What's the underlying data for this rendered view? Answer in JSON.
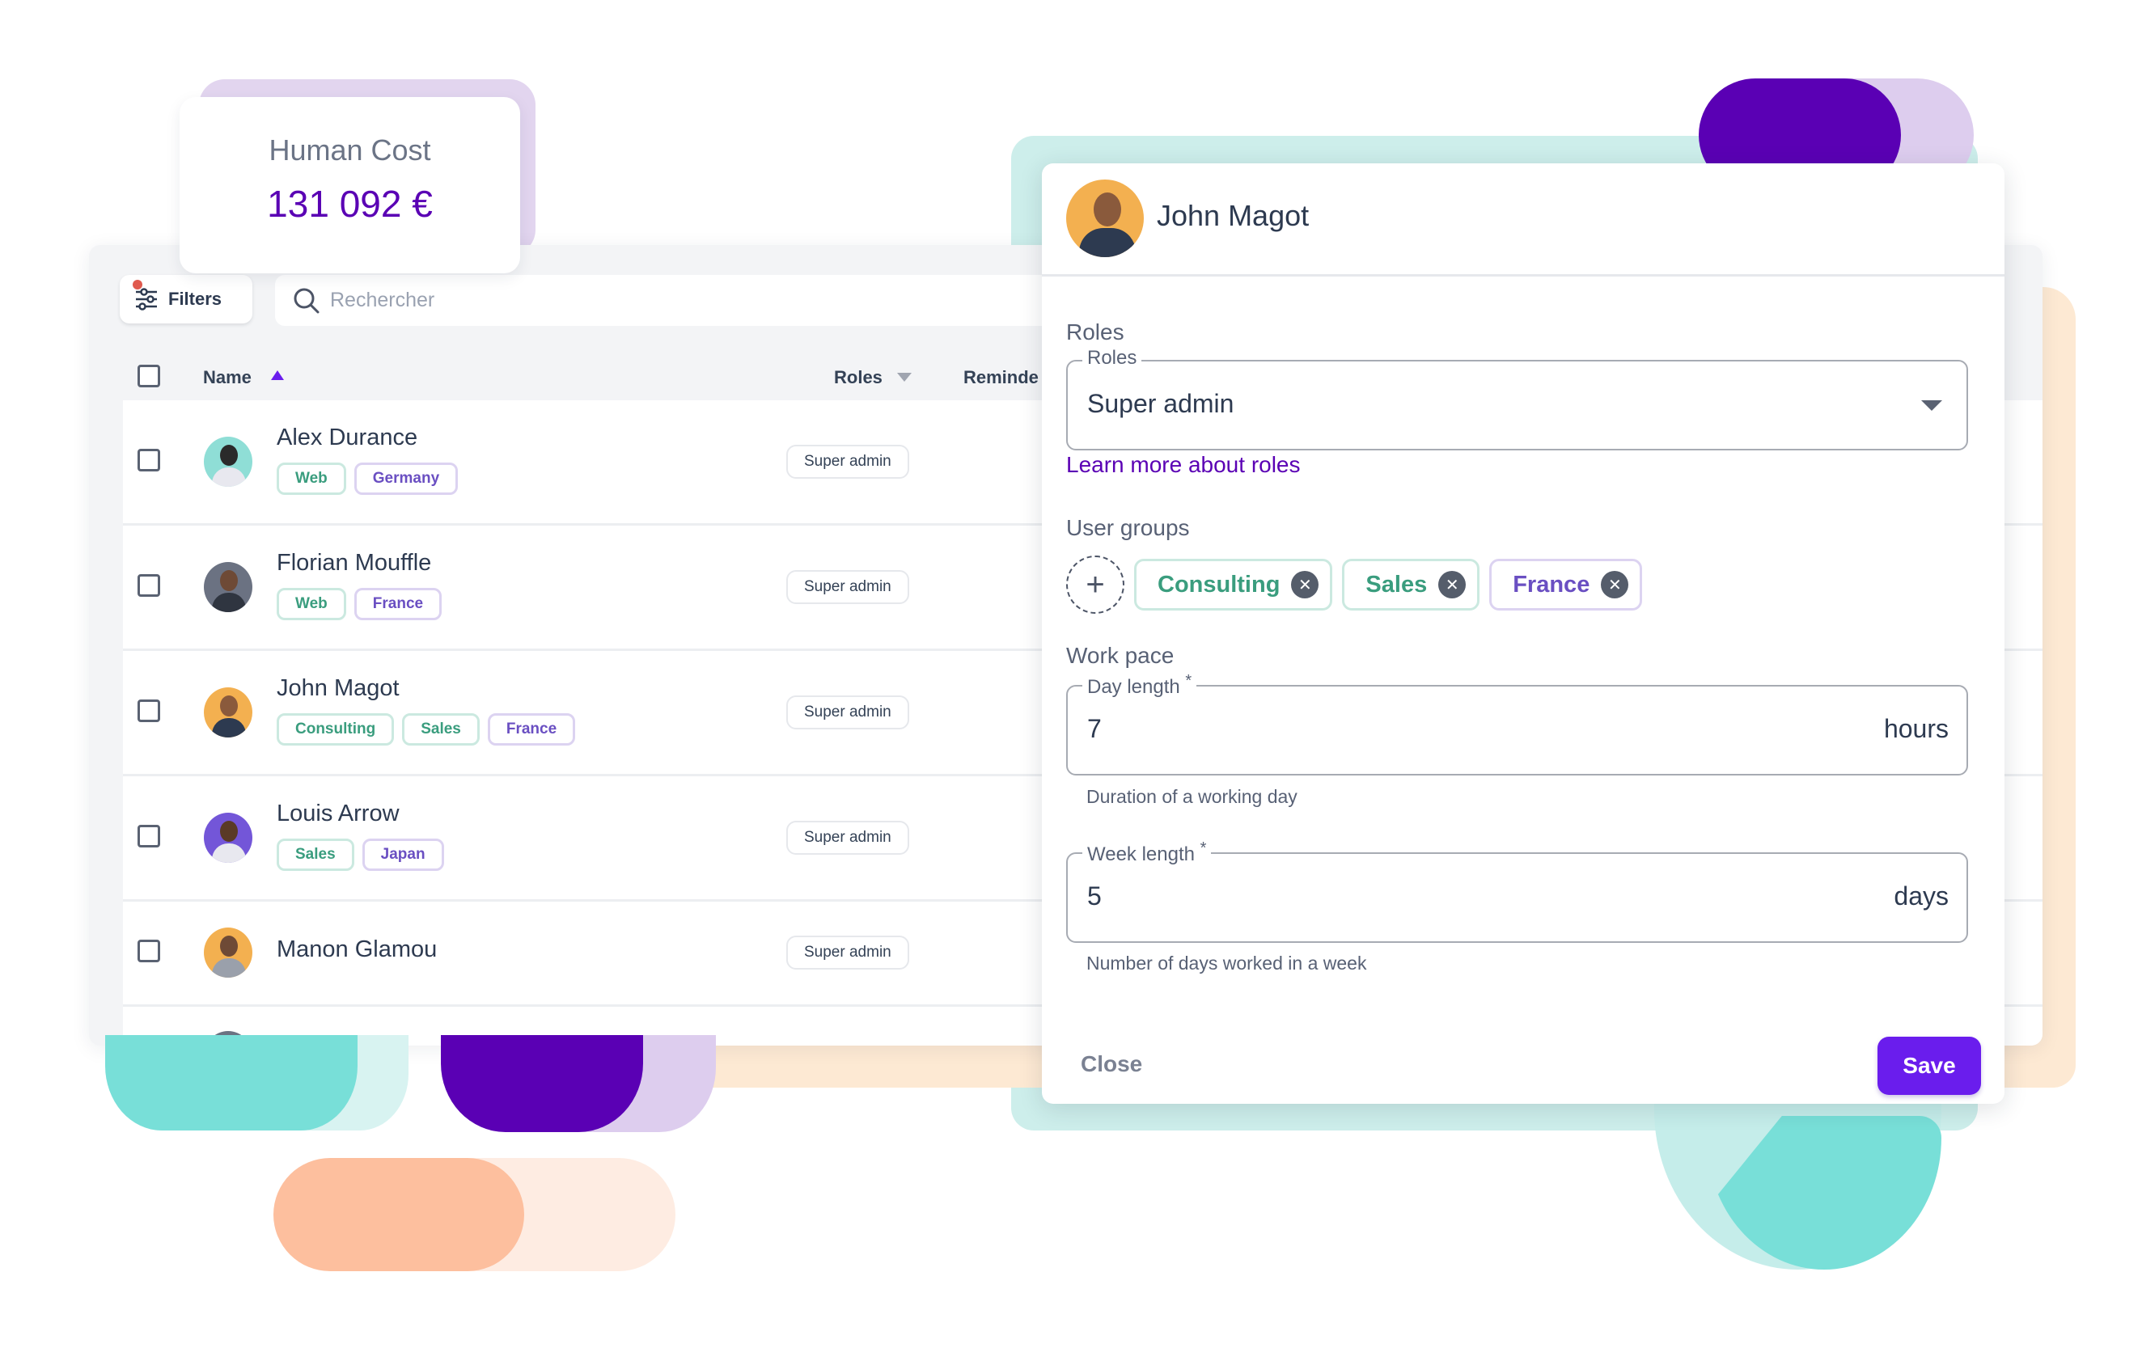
{
  "cost_card": {
    "label": "Human Cost",
    "value": "131 092 €"
  },
  "toolbar": {
    "filters_label": "Filters",
    "search_placeholder": "Rechercher"
  },
  "table": {
    "columns": {
      "name": "Name",
      "roles": "Roles",
      "reminders": "Reminde"
    },
    "rows": [
      {
        "name": "Alex Durance",
        "tags": [
          {
            "label": "Web",
            "kind": "green"
          },
          {
            "label": "Germany",
            "kind": "purple"
          }
        ],
        "role": "Super admin",
        "avatar_bg": "#8fded6",
        "hair": "#2a2a2a",
        "shirt": "#e8e8ef"
      },
      {
        "name": "Florian Mouffle",
        "tags": [
          {
            "label": "Web",
            "kind": "green"
          },
          {
            "label": "France",
            "kind": "purple"
          }
        ],
        "role": "Super admin",
        "avatar_bg": "#6b7282",
        "hair": "#6e4a36",
        "shirt": "#2f3540"
      },
      {
        "name": "John Magot",
        "tags": [
          {
            "label": "Consulting",
            "kind": "green"
          },
          {
            "label": "Sales",
            "kind": "green"
          },
          {
            "label": "France",
            "kind": "purple"
          }
        ],
        "role": "Super admin",
        "avatar_bg": "#f3b050",
        "hair": "#8a5a3c",
        "shirt": "#2d3a50"
      },
      {
        "name": "Louis Arrow",
        "tags": [
          {
            "label": "Sales",
            "kind": "green"
          },
          {
            "label": "Japan",
            "kind": "purple"
          }
        ],
        "role": "Super admin",
        "avatar_bg": "#7356d8",
        "hair": "#5a3a26",
        "shirt": "#e8e8ef"
      },
      {
        "name": "Manon Glamou",
        "tags": [],
        "role": "Super admin",
        "avatar_bg": "#f3b050",
        "hair": "#6e4a36",
        "shirt": "#9aa0ab"
      }
    ]
  },
  "modal": {
    "user_name": "John Magot",
    "roles_section": "Roles",
    "roles_field": {
      "legend": "Roles",
      "value": "Super admin"
    },
    "learn_more": "Learn more about roles",
    "groups_section": "User groups",
    "add_group_symbol": "+",
    "groups": [
      {
        "label": "Consulting",
        "kind": "green"
      },
      {
        "label": "Sales",
        "kind": "green"
      },
      {
        "label": "France",
        "kind": "purple"
      }
    ],
    "work_pace_section": "Work pace",
    "day_length": {
      "legend": "Day length",
      "required": "*",
      "value": "7",
      "suffix": "hours",
      "help": "Duration of a working day"
    },
    "week_length": {
      "legend": "Week length",
      "required": "*",
      "value": "5",
      "suffix": "days",
      "help": "Number of days worked in a week"
    },
    "close_label": "Close",
    "save_label": "Save"
  },
  "colors": {
    "brand": "#5a00b4",
    "save": "#6a1ded",
    "tag_green": "#3a9d7e",
    "tag_purple": "#6a4fc2"
  }
}
